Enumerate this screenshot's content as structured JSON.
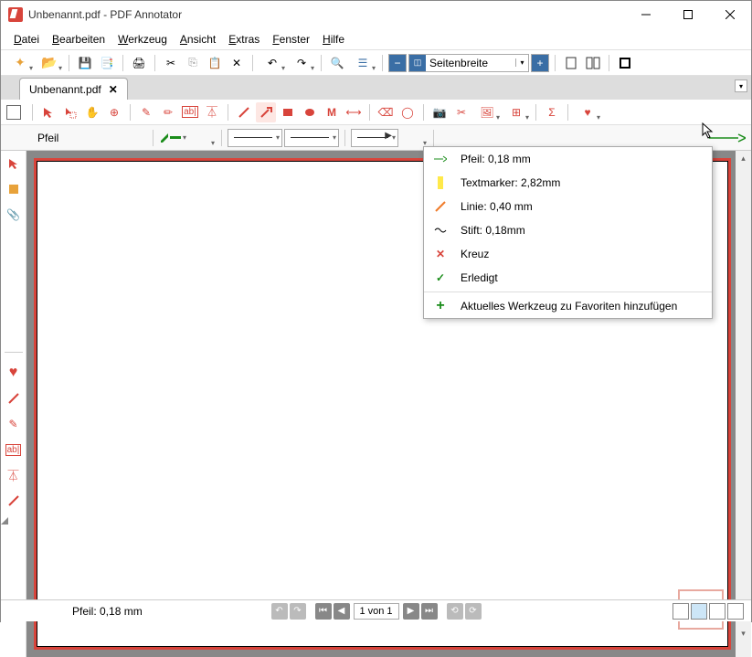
{
  "window": {
    "title": "Unbenannt.pdf - PDF Annotator"
  },
  "menu": {
    "file": "Datei",
    "file_u": "D",
    "edit": "Bearbeiten",
    "edit_u": "B",
    "tool": "Werkzeug",
    "tool_u": "W",
    "view": "Ansicht",
    "view_u": "A",
    "extras": "Extras",
    "extras_u": "E",
    "window": "Fenster",
    "window_u": "F",
    "help": "Hilfe",
    "help_u": "H"
  },
  "zoom": {
    "mode": "Seitenbreite"
  },
  "tab": {
    "name": "Unbenannt.pdf"
  },
  "current_tool": {
    "name": "Pfeil"
  },
  "favorites_menu": {
    "items": [
      {
        "icon": "arrow-green",
        "label": "Pfeil: 0,18 mm"
      },
      {
        "icon": "highlighter-yellow",
        "label": "Textmarker: 2,82mm"
      },
      {
        "icon": "line-orange",
        "label": "Linie: 0,40 mm"
      },
      {
        "icon": "pen-black",
        "label": "Stift: 0,18mm"
      },
      {
        "icon": "cross-red",
        "label": "Kreuz"
      },
      {
        "icon": "check-green",
        "label": "Erledigt"
      }
    ],
    "add": "Aktuelles Werkzeug zu Favoriten hinzufügen"
  },
  "status": {
    "tool_hint": "Pfeil: 0,18 mm",
    "page": "1 von 1"
  },
  "colors": {
    "accent": "#d8443b",
    "green": "#1a8c1a"
  }
}
